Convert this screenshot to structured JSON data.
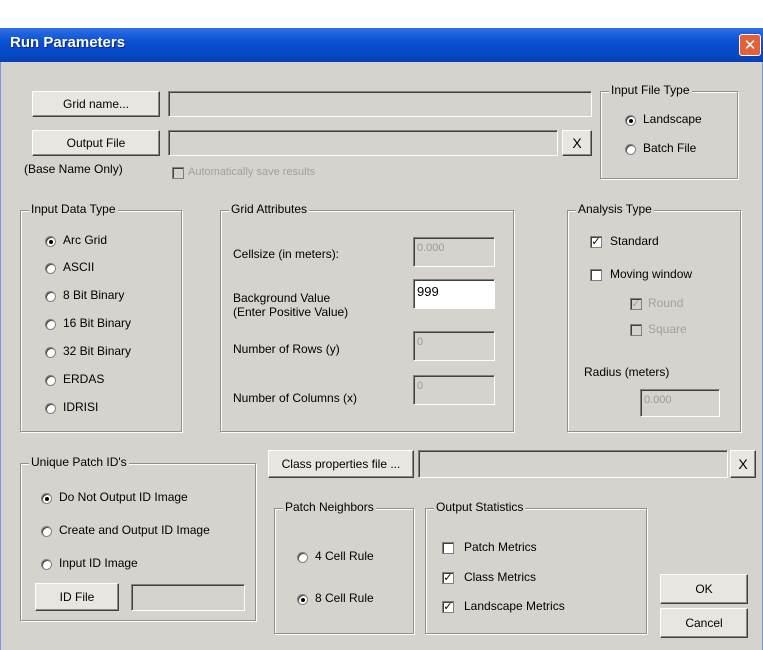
{
  "window": {
    "title": "Run Parameters",
    "close_glyph": "✕"
  },
  "top": {
    "grid_name_button": "Grid name...",
    "grid_name_value": "",
    "output_file_button": "Output File",
    "output_file_value": "",
    "output_clear_glyph": "X",
    "base_name_note": "(Base Name Only)",
    "autosave_label": "Automatically save results"
  },
  "input_file_type": {
    "title": "Input File Type",
    "options": [
      {
        "label": "Landscape",
        "selected": true
      },
      {
        "label": "Batch File",
        "selected": false
      }
    ]
  },
  "input_data_type": {
    "title": "Input Data Type",
    "options": [
      {
        "label": "Arc Grid",
        "selected": true
      },
      {
        "label": "ASCII",
        "selected": false
      },
      {
        "label": "8 Bit Binary",
        "selected": false
      },
      {
        "label": "16 Bit Binary",
        "selected": false
      },
      {
        "label": "32 Bit Binary",
        "selected": false
      },
      {
        "label": "ERDAS",
        "selected": false
      },
      {
        "label": "IDRISI",
        "selected": false
      }
    ]
  },
  "grid_attributes": {
    "title": "Grid Attributes",
    "cellsize_label": "Cellsize (in meters):",
    "cellsize_value": "0.000",
    "background_label_1": "Background Value",
    "background_label_2": "(Enter Positive Value)",
    "background_value": "999",
    "rows_label": "Number of Rows (y)",
    "rows_value": "0",
    "cols_label": "Number of Columns (x)",
    "cols_value": "0"
  },
  "analysis_type": {
    "title": "Analysis Type",
    "standard_label": "Standard",
    "standard_checked": true,
    "moving_label": "Moving window",
    "moving_checked": false,
    "round_label": "Round",
    "round_checked": true,
    "square_label": "Square",
    "square_checked": false,
    "radius_label": "Radius (meters)",
    "radius_value": "0.000"
  },
  "unique_patch": {
    "title": "Unique Patch ID's",
    "options": [
      {
        "label": "Do Not Output ID Image",
        "selected": true
      },
      {
        "label": "Create and Output ID Image",
        "selected": false
      },
      {
        "label": "Input ID Image",
        "selected": false
      }
    ],
    "id_file_button": "ID File",
    "id_file_value": ""
  },
  "class_props": {
    "button": "Class properties file ...",
    "value": "",
    "clear_glyph": "X"
  },
  "patch_neighbors": {
    "title": "Patch Neighbors",
    "options": [
      {
        "label": "4 Cell Rule",
        "selected": false
      },
      {
        "label": "8 Cell Rule",
        "selected": true
      }
    ]
  },
  "output_statistics": {
    "title": "Output Statistics",
    "patch_label": "Patch Metrics",
    "patch_checked": false,
    "class_label": "Class Metrics",
    "class_checked": true,
    "landscape_label": "Landscape Metrics",
    "landscape_checked": true
  },
  "buttons": {
    "ok": "OK",
    "cancel": "Cancel"
  },
  "check_glyph": "✓"
}
